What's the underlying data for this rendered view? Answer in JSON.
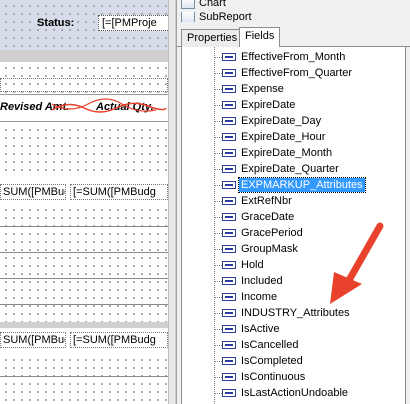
{
  "designer": {
    "status_label": "Status:",
    "status_value": "[=[PMProje",
    "column_revised": "Revised Amt.",
    "column_actual": "Actual Qty.",
    "sum_row1": [
      "SUM([PMBudg",
      "[=SUM([PMBudg"
    ],
    "sum_row2": [
      "SUM([PMBudg",
      "[=SUM([PMBudg"
    ]
  },
  "panel": {
    "top_items": [
      {
        "label": "Chart",
        "icon": "chart-icon"
      },
      {
        "label": "SubReport",
        "icon": "subreport-icon"
      }
    ],
    "tabs": [
      {
        "label": "Properties",
        "active": false
      },
      {
        "label": "Fields",
        "active": true
      }
    ],
    "fields": [
      {
        "label": "EffectiveFrom_Month"
      },
      {
        "label": "EffectiveFrom_Quarter"
      },
      {
        "label": "Expense"
      },
      {
        "label": "ExpireDate"
      },
      {
        "label": "ExpireDate_Day"
      },
      {
        "label": "ExpireDate_Hour"
      },
      {
        "label": "ExpireDate_Month"
      },
      {
        "label": "ExpireDate_Quarter"
      },
      {
        "label": "EXPMARKUP_Attributes",
        "selected": true
      },
      {
        "label": "ExtRefNbr"
      },
      {
        "label": "GraceDate"
      },
      {
        "label": "GracePeriod"
      },
      {
        "label": "GroupMask"
      },
      {
        "label": "Hold"
      },
      {
        "label": "Included"
      },
      {
        "label": "Income"
      },
      {
        "label": "INDUSTRY_Attributes"
      },
      {
        "label": "IsActive"
      },
      {
        "label": "IsCancelled"
      },
      {
        "label": "IsCompleted"
      },
      {
        "label": "IsContinuous"
      },
      {
        "label": "IsLastActionUndoable"
      }
    ]
  },
  "colors": {
    "selection": "#3399ff",
    "annotation_arrow": "#e8412c"
  }
}
